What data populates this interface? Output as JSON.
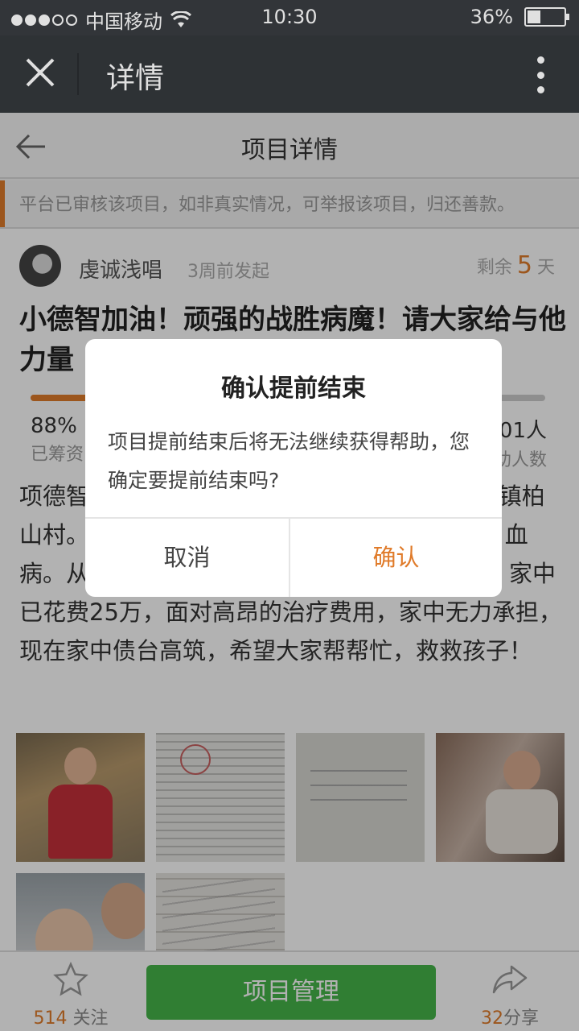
{
  "status": {
    "carrier": "中国移动",
    "time": "10:30",
    "battery": "36%",
    "battery_level": 0.36
  },
  "nav": {
    "title": "详情"
  },
  "subheader": {
    "title": "项目详情"
  },
  "notice": "平台已审核该项目，如非真实情况，可举报该项目，归还善款。",
  "project": {
    "author": "虔诚浅唱",
    "posted": "3周前发起",
    "remain_prefix": "剩余",
    "remain_days": "5",
    "remain_suffix": "天",
    "title": "小德智加油！顽强的战胜病魔！请大家给与他力量",
    "progress_fraction": 0.88,
    "raised_percent": "88%",
    "raised_label": "已筹资",
    "supporters_value": "101人",
    "supporters_label": "帮助人数",
    "description": "项德智，男，出生于2012年，家住山东省齐村镇柏山村。2014年12月，被确诊为急性淋巴细胞白血病。从发现到现在治疗，经历了一年半的时间，家中已花费25万，面对高昂的治疗费用，家中无力承担，现在家中债台高筑，希望大家帮帮忙，救救孩子！"
  },
  "bottom": {
    "follow_count": "514",
    "follow_label": "关注",
    "manage_label": "项目管理",
    "share_count": "32",
    "share_label": "分享"
  },
  "dialog": {
    "title": "确认提前结束",
    "message": "项目提前结束后将无法继续获得帮助，您确定要提前结束吗?",
    "cancel": "取消",
    "confirm": "确认"
  },
  "colors": {
    "accent": "#e07b2a",
    "green": "#46b54a",
    "navbar": "#35393d"
  }
}
